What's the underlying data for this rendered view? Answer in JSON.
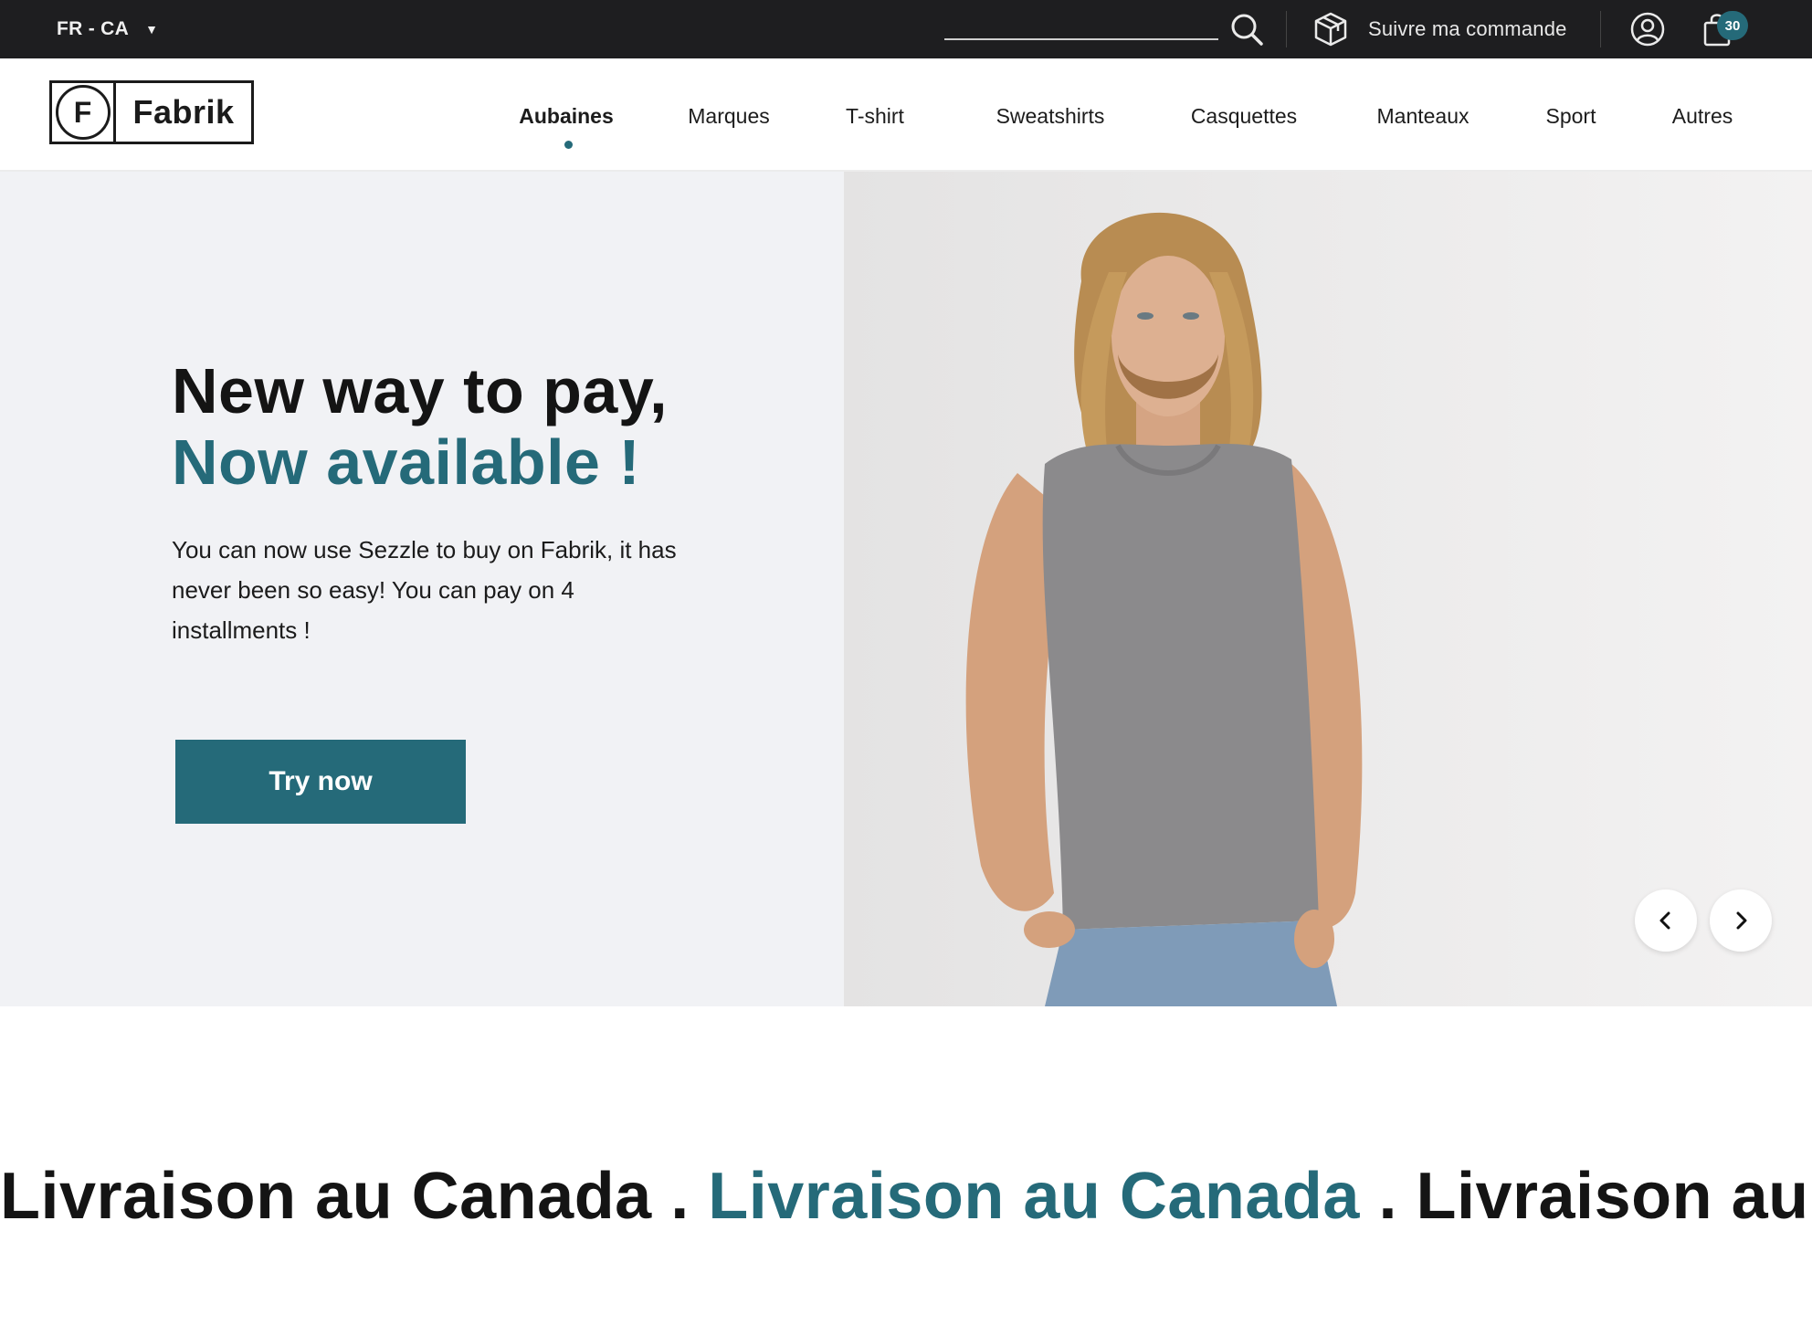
{
  "topbar": {
    "locale": "FR - CA",
    "search_placeholder": "",
    "track_order_label": "Suivre ma commande",
    "cart_count": "30"
  },
  "header": {
    "logo_letter": "F",
    "logo_text": "Fabrik",
    "nav": [
      {
        "label": "Aubaines",
        "active": true
      },
      {
        "label": "Marques"
      },
      {
        "label": "T-shirt"
      },
      {
        "label": "Sweatshirts"
      },
      {
        "label": "Casquettes"
      },
      {
        "label": "Manteaux"
      },
      {
        "label": "Sport"
      },
      {
        "label": "Autres"
      }
    ]
  },
  "hero": {
    "title_line1": "New way to pay,",
    "title_line2": "Now available !",
    "body": "You can now use Sezzle to buy on Fabrik, it has never been so easy! You can pay on 4 installments !",
    "cta_label": "Try now"
  },
  "marquee": {
    "item1": "Livraison au Canada",
    "sep1": " . ",
    "item2": "Livraison au Canada",
    "sep2": " . ",
    "item3": "Livraison au Canada"
  },
  "colors": {
    "accent": "#256a79",
    "topbar_bg": "#1e1e20",
    "hero_bg": "#f1f2f5"
  },
  "icons": {
    "search": "search-icon",
    "track": "package-icon",
    "account": "user-circle-icon",
    "cart": "shopping-bag-icon",
    "prev": "chevron-left-icon",
    "next": "chevron-right-icon"
  }
}
